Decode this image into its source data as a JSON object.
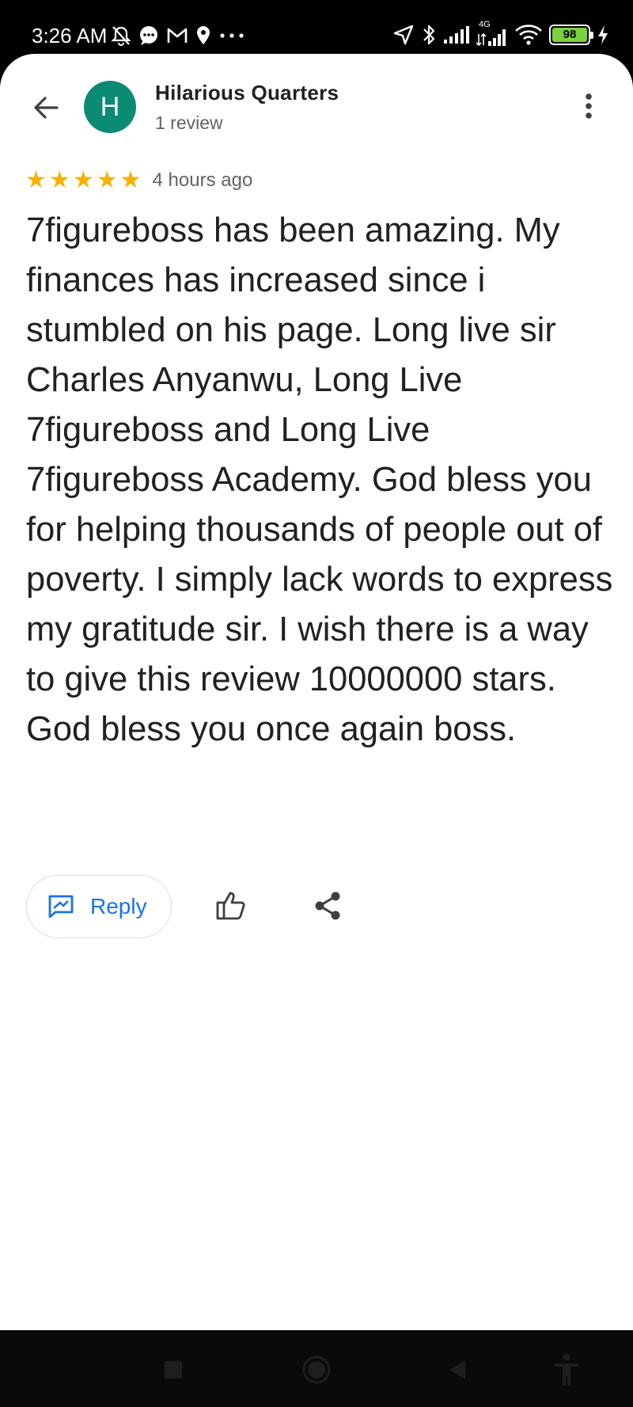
{
  "status_bar": {
    "time": "3:26 AM",
    "network_label": "4G",
    "battery_level": "98",
    "icons_left": [
      "alarm-off-icon",
      "chat-icon",
      "gmail-icon",
      "location-pin-icon",
      "more-notifications-icon"
    ],
    "icons_right": [
      "navigation-icon",
      "bluetooth-icon",
      "signal-icon",
      "signal-4g-icon",
      "wifi-icon",
      "battery-icon",
      "charging-icon"
    ]
  },
  "header": {
    "avatar_letter": "H",
    "avatar_color": "#0b8a74",
    "reviewer_name": "Hilarious Quarters",
    "review_count": "1 review"
  },
  "review": {
    "stars": 5,
    "star_color": "#f4b400",
    "time_ago": "4 hours ago",
    "text": "7figureboss has been amazing. My finances has increased since i stumbled on his page. Long live sir Charles Anyanwu, Long Live 7figureboss and Long Live 7figureboss Academy. God bless you for helping thousands of people out of poverty. I simply lack words to express my gratitude sir. I wish there is a way to give this review 10000000 stars. God bless you once again boss."
  },
  "actions": {
    "reply_label": "Reply",
    "accent_color": "#1a73e8"
  }
}
